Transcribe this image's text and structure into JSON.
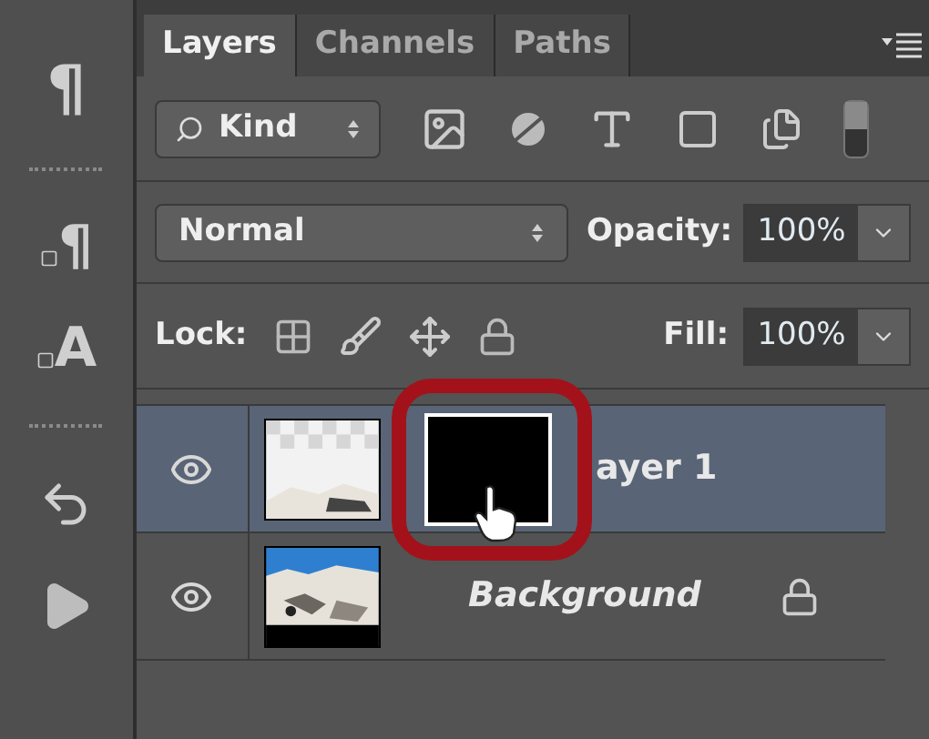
{
  "side_toolbar": [
    {
      "kind": "glyph",
      "glyph": "¶"
    },
    {
      "kind": "grip"
    },
    {
      "kind": "glyph-stack",
      "glyph": "¶"
    },
    {
      "kind": "glyph-stack",
      "glyph": "A"
    },
    {
      "kind": "grip"
    },
    {
      "kind": "history"
    },
    {
      "kind": "play"
    }
  ],
  "tabs": [
    {
      "label": "Layers",
      "selected": true
    },
    {
      "label": "Channels",
      "selected": false
    },
    {
      "label": "Paths",
      "selected": false
    }
  ],
  "filter": {
    "value": "Kind"
  },
  "blend_mode": {
    "value": "Normal"
  },
  "opacity": {
    "label": "Opacity:",
    "value": "100%"
  },
  "lock": {
    "label": "Lock:"
  },
  "fill": {
    "label": "Fill:",
    "value": "100%"
  },
  "layers": [
    {
      "name": "ayer 1",
      "kind": "masked",
      "selected": true,
      "visible": true,
      "locked": false
    },
    {
      "name": "Background",
      "kind": "background",
      "selected": false,
      "visible": true,
      "locked": true
    }
  ]
}
